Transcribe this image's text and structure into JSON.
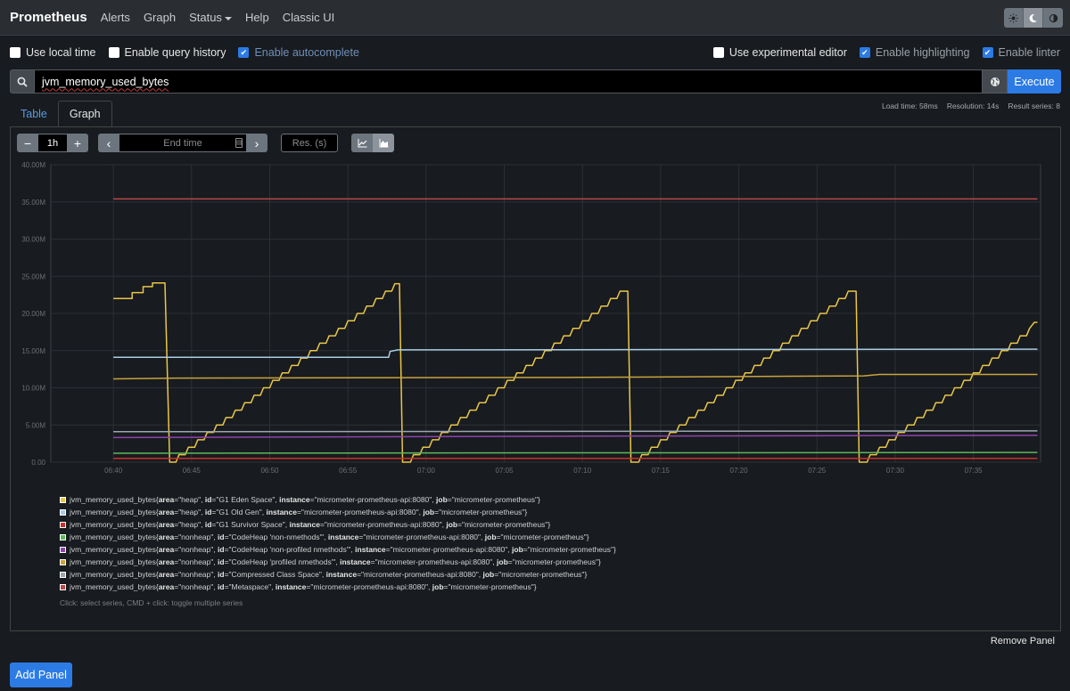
{
  "navbar": {
    "brand": "Prometheus",
    "links": [
      "Alerts",
      "Graph",
      "Status",
      "Help",
      "Classic UI"
    ],
    "theme_icons": [
      "sun-icon",
      "moon-icon",
      "half-circle-icon"
    ],
    "active_theme": "moon"
  },
  "options": {
    "left": [
      {
        "label": "Use local time",
        "checked": false
      },
      {
        "label": "Enable query history",
        "checked": false
      },
      {
        "label": "Enable autocomplete",
        "checked": true
      }
    ],
    "right": [
      {
        "label": "Use experimental editor",
        "checked": false
      },
      {
        "label": "Enable highlighting",
        "checked": true
      },
      {
        "label": "Enable linter",
        "checked": true
      }
    ]
  },
  "query": {
    "expression": "jvm_memory_used_bytes",
    "execute_label": "Execute"
  },
  "tabs": {
    "table": "Table",
    "graph": "Graph",
    "active": "graph"
  },
  "meta": {
    "load_time": "Load time: 58ms",
    "resolution": "Resolution: 14s",
    "result_series": "Result series: 8"
  },
  "controls": {
    "range": "1h",
    "end_time_placeholder": "End time",
    "resolution_placeholder": "Res. (s)",
    "minus": "−",
    "plus": "+",
    "prev": "‹",
    "next": "›",
    "stacked": false
  },
  "chart_data": {
    "type": "line",
    "y_ticks": [
      "0.00",
      "5.00M",
      "10.00M",
      "15.00M",
      "20.00M",
      "25.00M",
      "30.00M",
      "35.00M",
      "40.00M"
    ],
    "ylim": [
      0,
      40000000
    ],
    "x_ticks": [
      "06:40",
      "06:45",
      "06:50",
      "06:55",
      "07:00",
      "07:05",
      "07:10",
      "07:15",
      "07:20",
      "07:25",
      "07:30",
      "07:35"
    ],
    "grid": true,
    "series": [
      {
        "name": "G1 Eden Space",
        "color": "#e9c649",
        "points": [
          [
            0,
            22.0
          ],
          [
            1.2,
            22.0
          ],
          [
            1.2,
            22.8
          ],
          [
            1.9,
            22.8
          ],
          [
            1.9,
            23.6
          ],
          [
            2.5,
            23.6
          ],
          [
            2.5,
            24.1
          ],
          [
            3.3,
            24.1
          ],
          [
            3.6,
            0
          ],
          [
            4.0,
            0
          ],
          [
            4.2,
            1.0
          ],
          [
            4.6,
            1.0
          ],
          [
            4.8,
            2.0
          ],
          [
            5.2,
            2.0
          ],
          [
            5.4,
            3.0
          ],
          [
            5.8,
            3.0
          ],
          [
            6.0,
            4.0
          ],
          [
            6.4,
            4.0
          ],
          [
            6.6,
            5.0
          ],
          [
            7.0,
            5.0
          ],
          [
            7.2,
            6.0
          ],
          [
            7.6,
            6.0
          ],
          [
            7.8,
            7.0
          ],
          [
            8.2,
            7.0
          ],
          [
            8.4,
            8.0
          ],
          [
            8.8,
            8.0
          ],
          [
            9.0,
            9.0
          ],
          [
            9.4,
            9.0
          ],
          [
            9.6,
            10.0
          ],
          [
            10.0,
            10.0
          ],
          [
            10.2,
            11.0
          ],
          [
            10.6,
            11.0
          ],
          [
            10.8,
            12.0
          ],
          [
            11.2,
            12.0
          ],
          [
            11.4,
            13.0
          ],
          [
            11.8,
            13.0
          ],
          [
            12.0,
            14.0
          ],
          [
            12.4,
            14.0
          ],
          [
            12.6,
            15.0
          ],
          [
            13.0,
            15.0
          ],
          [
            13.2,
            16.0
          ],
          [
            13.6,
            16.0
          ],
          [
            13.8,
            17.0
          ],
          [
            14.2,
            17.0
          ],
          [
            14.4,
            18.0
          ],
          [
            14.8,
            18.0
          ],
          [
            15.0,
            19.0
          ],
          [
            15.4,
            19.0
          ],
          [
            15.6,
            20.0
          ],
          [
            16.0,
            20.0
          ],
          [
            16.2,
            21.0
          ],
          [
            16.6,
            21.0
          ],
          [
            16.8,
            22.0
          ],
          [
            17.2,
            22.0
          ],
          [
            17.4,
            23.0
          ],
          [
            17.8,
            23.0
          ],
          [
            18.0,
            24.0
          ],
          [
            18.3,
            24.0
          ],
          [
            18.5,
            0
          ],
          [
            19.0,
            0
          ],
          [
            19.2,
            1.0
          ],
          [
            19.6,
            1.0
          ],
          [
            19.8,
            2.0
          ],
          [
            20.2,
            2.0
          ],
          [
            20.4,
            3.0
          ],
          [
            20.8,
            3.0
          ],
          [
            21.0,
            4.0
          ],
          [
            21.4,
            4.0
          ],
          [
            21.6,
            5.0
          ],
          [
            22.0,
            5.0
          ],
          [
            22.2,
            6.0
          ],
          [
            22.6,
            6.0
          ],
          [
            22.8,
            7.0
          ],
          [
            23.2,
            7.0
          ],
          [
            23.4,
            8.0
          ],
          [
            23.8,
            8.0
          ],
          [
            24.0,
            9.0
          ],
          [
            24.4,
            9.0
          ],
          [
            24.6,
            10.0
          ],
          [
            25.0,
            10.0
          ],
          [
            25.2,
            11.0
          ],
          [
            25.6,
            11.0
          ],
          [
            25.8,
            12.0
          ],
          [
            26.2,
            12.0
          ],
          [
            26.4,
            13.0
          ],
          [
            26.8,
            13.0
          ],
          [
            27.0,
            14.0
          ],
          [
            27.4,
            14.0
          ],
          [
            27.6,
            15.0
          ],
          [
            28.0,
            15.0
          ],
          [
            28.2,
            16.0
          ],
          [
            28.6,
            16.0
          ],
          [
            28.8,
            17.0
          ],
          [
            29.2,
            17.0
          ],
          [
            29.4,
            18.0
          ],
          [
            29.8,
            18.0
          ],
          [
            30.0,
            19.0
          ],
          [
            30.4,
            19.0
          ],
          [
            30.6,
            20.0
          ],
          [
            31.0,
            20.0
          ],
          [
            31.2,
            21.0
          ],
          [
            31.6,
            21.0
          ],
          [
            31.8,
            22.0
          ],
          [
            32.2,
            22.0
          ],
          [
            32.4,
            23.0
          ],
          [
            32.9,
            23.0
          ],
          [
            33.1,
            0
          ],
          [
            33.6,
            0
          ],
          [
            33.8,
            1.0
          ],
          [
            34.2,
            1.0
          ],
          [
            34.4,
            2.0
          ],
          [
            34.8,
            2.0
          ],
          [
            35.0,
            3.0
          ],
          [
            35.4,
            3.0
          ],
          [
            35.6,
            4.0
          ],
          [
            36.0,
            4.0
          ],
          [
            36.2,
            5.0
          ],
          [
            36.6,
            5.0
          ],
          [
            36.8,
            6.0
          ],
          [
            37.2,
            6.0
          ],
          [
            37.4,
            7.0
          ],
          [
            37.8,
            7.0
          ],
          [
            38.0,
            8.0
          ],
          [
            38.4,
            8.0
          ],
          [
            38.6,
            9.0
          ],
          [
            39.0,
            9.0
          ],
          [
            39.2,
            10.0
          ],
          [
            39.6,
            10.0
          ],
          [
            39.8,
            11.0
          ],
          [
            40.2,
            11.0
          ],
          [
            40.4,
            12.0
          ],
          [
            40.8,
            12.0
          ],
          [
            41.0,
            13.0
          ],
          [
            41.4,
            13.0
          ],
          [
            41.6,
            14.0
          ],
          [
            42.0,
            14.0
          ],
          [
            42.2,
            15.0
          ],
          [
            42.6,
            15.0
          ],
          [
            42.8,
            16.0
          ],
          [
            43.2,
            16.0
          ],
          [
            43.4,
            17.0
          ],
          [
            43.8,
            17.0
          ],
          [
            44.0,
            18.0
          ],
          [
            44.4,
            18.0
          ],
          [
            44.6,
            19.0
          ],
          [
            45.0,
            19.0
          ],
          [
            45.2,
            20.0
          ],
          [
            45.6,
            20.0
          ],
          [
            45.8,
            21.0
          ],
          [
            46.2,
            21.0
          ],
          [
            46.4,
            22.0
          ],
          [
            46.8,
            22.0
          ],
          [
            47.0,
            23.0
          ],
          [
            47.5,
            23.0
          ],
          [
            47.7,
            0
          ],
          [
            48.2,
            0
          ],
          [
            48.4,
            1.0
          ],
          [
            48.8,
            1.0
          ],
          [
            49.0,
            2.0
          ],
          [
            49.4,
            2.0
          ],
          [
            49.6,
            3.0
          ],
          [
            50.0,
            3.0
          ],
          [
            50.2,
            4.0
          ],
          [
            50.6,
            4.0
          ],
          [
            50.8,
            5.0
          ],
          [
            51.2,
            5.0
          ],
          [
            51.4,
            6.0
          ],
          [
            51.8,
            6.0
          ],
          [
            52.0,
            7.0
          ],
          [
            52.4,
            7.0
          ],
          [
            52.6,
            8.0
          ],
          [
            53.0,
            8.0
          ],
          [
            53.2,
            9.0
          ],
          [
            53.6,
            9.0
          ],
          [
            53.8,
            10.0
          ],
          [
            54.2,
            10.0
          ],
          [
            54.4,
            11.0
          ],
          [
            54.8,
            11.0
          ],
          [
            55.0,
            12.0
          ],
          [
            55.4,
            12.0
          ],
          [
            55.6,
            13.0
          ],
          [
            56.0,
            13.0
          ],
          [
            56.2,
            14.0
          ],
          [
            56.6,
            14.0
          ],
          [
            56.8,
            15.0
          ],
          [
            57.2,
            15.0
          ],
          [
            57.4,
            16.0
          ],
          [
            57.8,
            16.0
          ],
          [
            58.0,
            17.0
          ],
          [
            58.4,
            17.0
          ],
          [
            58.6,
            18.0
          ],
          [
            58.9,
            18.8
          ],
          [
            59.1,
            18.8
          ]
        ]
      },
      {
        "name": "G1 Old Gen",
        "color": "#a9cce3",
        "points": [
          [
            0,
            14.1
          ],
          [
            17.6,
            14.1
          ],
          [
            17.7,
            14.9
          ],
          [
            18.2,
            15.1
          ],
          [
            59.1,
            15.2
          ]
        ]
      },
      {
        "name": "G1 Survivor Space",
        "color": "#c9302c",
        "points": [
          [
            0,
            0.5
          ],
          [
            59.1,
            0.5
          ]
        ]
      },
      {
        "name": "CodeHeap 'non-nmethods'",
        "color": "#5cb85c",
        "points": [
          [
            0,
            1.2
          ],
          [
            59.1,
            1.3
          ]
        ]
      },
      {
        "name": "CodeHeap 'non-profiled nmethods'",
        "color": "#8e44ad",
        "points": [
          [
            0,
            3.3
          ],
          [
            30,
            3.5
          ],
          [
            59.1,
            3.6
          ]
        ]
      },
      {
        "name": "CodeHeap 'profiled nmethods'",
        "color": "#c9a33e",
        "points": [
          [
            0,
            11.2
          ],
          [
            4,
            11.3
          ],
          [
            30,
            11.4
          ],
          [
            48,
            11.6
          ],
          [
            49,
            11.8
          ],
          [
            59.1,
            11.8
          ]
        ]
      },
      {
        "name": "Compressed Class Space",
        "color": "#9aa7b0",
        "points": [
          [
            0,
            4.1
          ],
          [
            59.1,
            4.2
          ]
        ]
      },
      {
        "name": "Metaspace",
        "color": "#b84a4a",
        "points": [
          [
            0,
            35.4
          ],
          [
            59.1,
            35.4
          ]
        ]
      }
    ],
    "x_domain": [
      -4.0,
      59.3
    ]
  },
  "legend": {
    "items": [
      {
        "color": "#e9c649",
        "metric": "jvm_memory_used_bytes",
        "labels": [
          [
            "area",
            "heap"
          ],
          [
            "id",
            "G1 Eden Space"
          ],
          [
            "instance",
            "micrometer-prometheus-api:8080"
          ],
          [
            "job",
            "micrometer-prometheus"
          ]
        ]
      },
      {
        "color": "#a9cce3",
        "metric": "jvm_memory_used_bytes",
        "labels": [
          [
            "area",
            "heap"
          ],
          [
            "id",
            "G1 Old Gen"
          ],
          [
            "instance",
            "micrometer-prometheus-api:8080"
          ],
          [
            "job",
            "micrometer-prometheus"
          ]
        ]
      },
      {
        "color": "#c9302c",
        "metric": "jvm_memory_used_bytes",
        "labels": [
          [
            "area",
            "heap"
          ],
          [
            "id",
            "G1 Survivor Space"
          ],
          [
            "instance",
            "micrometer-prometheus-api:8080"
          ],
          [
            "job",
            "micrometer-prometheus"
          ]
        ]
      },
      {
        "color": "#5cb85c",
        "metric": "jvm_memory_used_bytes",
        "labels": [
          [
            "area",
            "nonheap"
          ],
          [
            "id",
            "CodeHeap 'non-nmethods'"
          ],
          [
            "instance",
            "micrometer-prometheus-api:8080"
          ],
          [
            "job",
            "micrometer-prometheus"
          ]
        ]
      },
      {
        "color": "#8e44ad",
        "metric": "jvm_memory_used_bytes",
        "labels": [
          [
            "area",
            "nonheap"
          ],
          [
            "id",
            "CodeHeap 'non-profiled nmethods'"
          ],
          [
            "instance",
            "micrometer-prometheus-api:8080"
          ],
          [
            "job",
            "micrometer-prometheus"
          ]
        ]
      },
      {
        "color": "#c9a33e",
        "metric": "jvm_memory_used_bytes",
        "labels": [
          [
            "area",
            "nonheap"
          ],
          [
            "id",
            "CodeHeap 'profiled nmethods'"
          ],
          [
            "instance",
            "micrometer-prometheus-api:8080"
          ],
          [
            "job",
            "micrometer-prometheus"
          ]
        ]
      },
      {
        "color": "#9aa7b0",
        "metric": "jvm_memory_used_bytes",
        "labels": [
          [
            "area",
            "nonheap"
          ],
          [
            "id",
            "Compressed Class Space"
          ],
          [
            "instance",
            "micrometer-prometheus-api:8080"
          ],
          [
            "job",
            "micrometer-prometheus"
          ]
        ]
      },
      {
        "color": "#b84a4a",
        "metric": "jvm_memory_used_bytes",
        "labels": [
          [
            "area",
            "nonheap"
          ],
          [
            "id",
            "Metaspace"
          ],
          [
            "instance",
            "micrometer-prometheus-api:8080"
          ],
          [
            "job",
            "micrometer-prometheus"
          ]
        ]
      }
    ],
    "hint": "Click: select series, CMD + click: toggle multiple series"
  },
  "panel": {
    "remove_label": "Remove Panel",
    "add_label": "Add Panel"
  }
}
